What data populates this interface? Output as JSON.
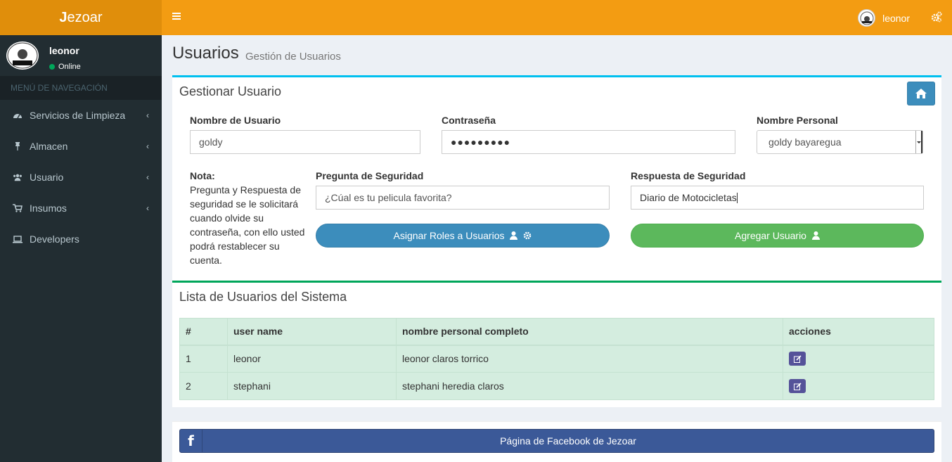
{
  "app": {
    "logo_first": "J",
    "logo_rest": "ezoar"
  },
  "topbar": {
    "user_name": "leonor"
  },
  "sidebar": {
    "user_name": "leonor",
    "status": "Online",
    "nav_header": "MENÚ DE NAVEGACIÓN",
    "items": [
      {
        "label": "Servicios de Limpieza",
        "icon": "dashboard-icon",
        "has_submenu": true
      },
      {
        "label": "Almacen",
        "icon": "pin-icon",
        "has_submenu": true
      },
      {
        "label": "Usuario",
        "icon": "users-icon",
        "has_submenu": true
      },
      {
        "label": "Insumos",
        "icon": "cart-icon",
        "has_submenu": true
      },
      {
        "label": "Developers",
        "icon": "laptop-icon",
        "has_submenu": false
      }
    ]
  },
  "page": {
    "title": "Usuarios",
    "subtitle": "Gestión de Usuarios"
  },
  "form": {
    "title": "Gestionar Usuario",
    "username_label": "Nombre de Usuario",
    "username_value": "goldy",
    "password_label": "Contraseña",
    "password_value": "●●●●●●●●●",
    "personal_name_label": "Nombre Personal",
    "personal_name_value": "goldy bayaregua",
    "note_title": "Nota:",
    "note_text": "Pregunta y Respuesta de seguridad se le solicitará cuando olvide su contraseña, con ello usted podrá restablecer su cuenta.",
    "question_label": "Pregunta de Seguridad",
    "question_value": "¿Cúal es tu pelicula favorita?",
    "answer_label": "Respuesta de Seguridad",
    "answer_value": "Diario de Motocicletas",
    "assign_roles_button": "Asignar Roles a Usuarios",
    "add_user_button": "Agregar Usuario"
  },
  "users_table": {
    "title": "Lista de Usuarios del Sistema",
    "columns": [
      "#",
      "user name",
      "nombre personal completo",
      "acciones"
    ],
    "rows": [
      {
        "num": "1",
        "user": "leonor",
        "full_name": "leonor claros torrico"
      },
      {
        "num": "2",
        "user": "stephani",
        "full_name": "stephani heredia claros"
      }
    ]
  },
  "footer": {
    "facebook_button": "Página de Facebook de Jezoar",
    "facebook_glyph": "f"
  },
  "colors": {
    "header": "#f39c12",
    "logo": "#e08e0b",
    "sidebar": "#222d32",
    "primary": "#3c8dbc",
    "success": "#5cb85c",
    "facebook": "#3b5998"
  }
}
